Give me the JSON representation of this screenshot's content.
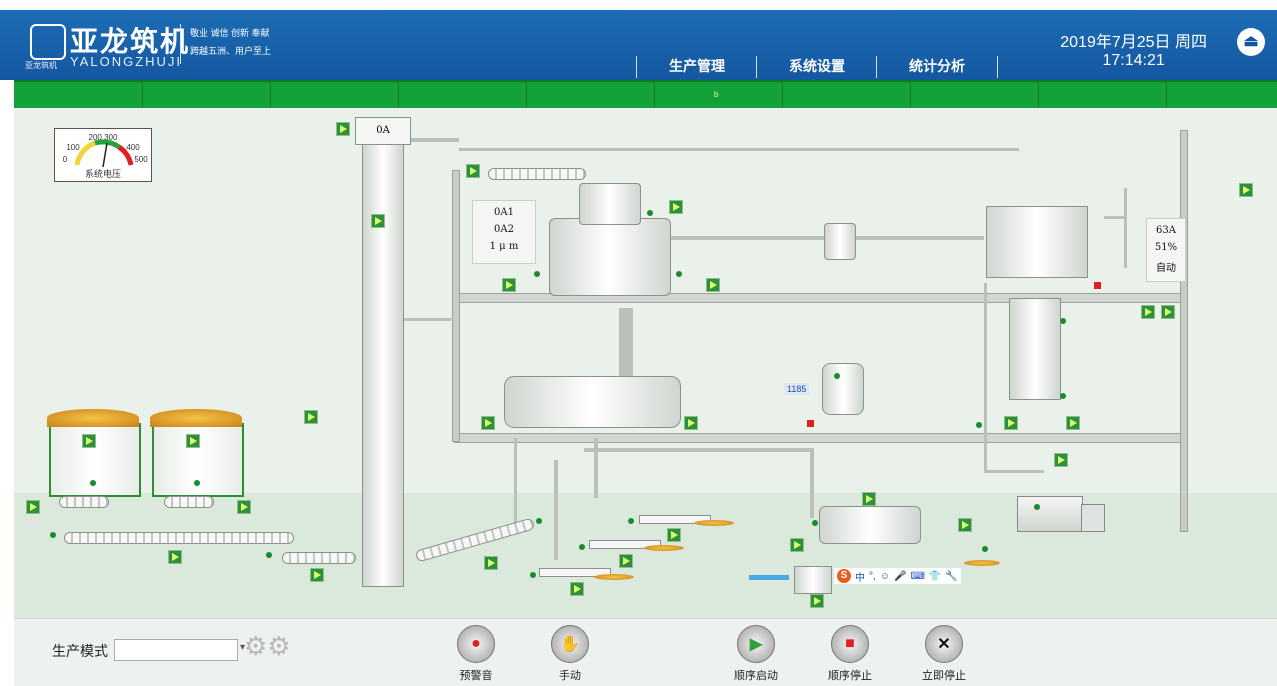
{
  "header": {
    "brand_cn": "亚龙筑机",
    "brand_en": "YALONGZHUJI",
    "brand_small": "亚龙筑机",
    "slogan_line1": "敬业 诚信 创新 奉献",
    "slogan_line2": "跨越五洲、用户至上",
    "nav": [
      "生产管理",
      "系统设置",
      "统计分析"
    ],
    "date": "2019年7月25日 周四",
    "time": "17:14:21",
    "logout_icon": "logout-icon"
  },
  "greenbar": {
    "marker": "b"
  },
  "scene": {
    "gauge": {
      "ticks": "200 300",
      "low": "100",
      "high": "400",
      "min": "0",
      "max": "500",
      "label": "系统电压"
    },
    "elevator_label": "0A",
    "left_panel": [
      "0A1",
      "0A2",
      "1 μ m"
    ],
    "right_panel": [
      "63A",
      "51%",
      "自动"
    ],
    "meter_value": "1185"
  },
  "ime_toolbar": {
    "logo": "S",
    "chinese": "中",
    "items": [
      "°,",
      "☺",
      "🎤",
      "⌨",
      "👕",
      "🔧"
    ]
  },
  "bottom": {
    "mode_label": "生产模式",
    "mode_value": "",
    "controls": [
      {
        "label": "预警音",
        "icon": "alarm-icon"
      },
      {
        "label": "手动",
        "icon": "hand-icon"
      },
      {
        "label": "顺序启动",
        "icon": "sequence-start-icon"
      },
      {
        "label": "顺序停止",
        "icon": "sequence-stop-icon"
      },
      {
        "label": "立即停止",
        "icon": "emergency-stop-icon"
      }
    ]
  }
}
